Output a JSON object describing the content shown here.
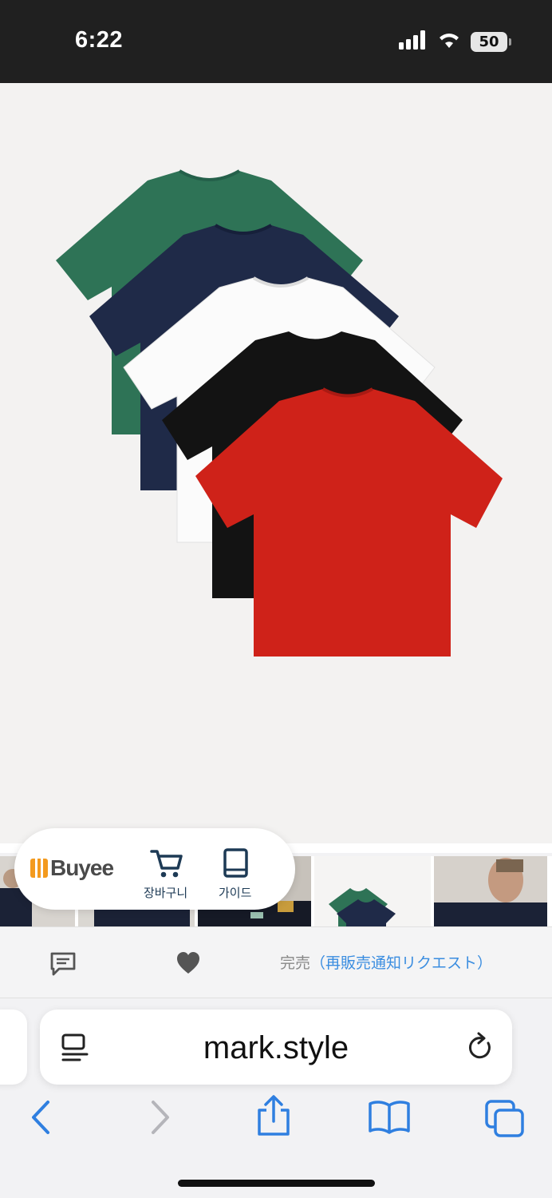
{
  "status_bar": {
    "time": "6:22",
    "battery": "50"
  },
  "buyee": {
    "logo_text": "Buyee",
    "cart_label": "장바구니",
    "guide_label": "가이드"
  },
  "action_bar": {
    "sold_out": "完売",
    "restock_request": "（再販売通知リクエスト）"
  },
  "safari": {
    "address": "mark.style"
  },
  "colors": {
    "status_bg": "#202020",
    "link_blue": "#3a8de0",
    "toolbar_blue": "#2f7fe0",
    "tee_green": "#2e7356",
    "tee_navy": "#1f2a48",
    "tee_white": "#fbfbfb",
    "tee_black": "#131313",
    "tee_red": "#cf2219"
  }
}
